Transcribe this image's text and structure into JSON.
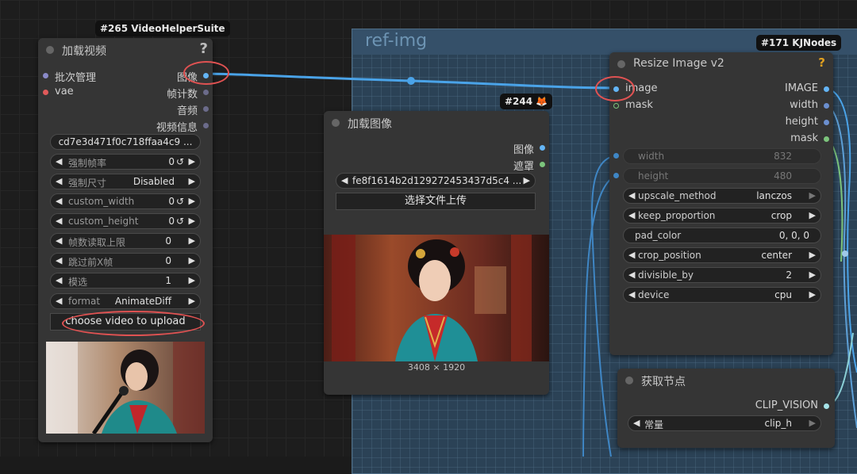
{
  "group": {
    "title": "ref-img"
  },
  "node265": {
    "badge": "#265 VideoHelperSuite",
    "title": "加载视频",
    "help_icon": "?",
    "inputs": [
      {
        "label": "批次管理",
        "color": "#8a8ac8"
      },
      {
        "label": "vae",
        "color": "#e05a5a"
      }
    ],
    "outputs": [
      "图像",
      "帧计数",
      "音频",
      "视频信息"
    ],
    "file_value": "cd7e3d471f0c718ffaa4c9 ...",
    "widgets": [
      {
        "label": "强制帧率",
        "value": "0",
        "suffix": "↺"
      },
      {
        "label": "强制尺寸",
        "value": "Disabled",
        "suffix": ""
      },
      {
        "label": "custom_width",
        "value": "0",
        "suffix": "↺"
      },
      {
        "label": "custom_height",
        "value": "0",
        "suffix": "↺"
      },
      {
        "label": "帧数读取上限",
        "value": "0",
        "suffix": ""
      },
      {
        "label": "跳过前X帧",
        "value": "0",
        "suffix": ""
      },
      {
        "label": "模选",
        "value": "1",
        "suffix": ""
      },
      {
        "label": "format",
        "value": "AnimateDiff",
        "suffix": ""
      }
    ],
    "upload_button": "choose video to upload"
  },
  "node244": {
    "badge": "#244 🦊",
    "title": "加载图像",
    "outputs": [
      "图像",
      "遮罩"
    ],
    "file_value": "fe8f1614b2d129272453437d5c4 ...",
    "upload_button": "选择文件上传",
    "image_caption": "3408 × 1920"
  },
  "node171": {
    "badge": "#171 KJNodes",
    "title": "Resize Image v2",
    "help_icon": "?",
    "inputs": [
      "image",
      "mask"
    ],
    "outputs": [
      "IMAGE",
      "width",
      "height",
      "mask"
    ],
    "disabled_widgets": [
      {
        "label": "width",
        "value": "832"
      },
      {
        "label": "height",
        "value": "480"
      }
    ],
    "widgets": [
      {
        "label": "upscale_method",
        "value": "lanczos"
      },
      {
        "label": "keep_proportion",
        "value": "crop"
      },
      {
        "label": "pad_color",
        "value": "0, 0, 0"
      },
      {
        "label": "crop_position",
        "value": "center"
      },
      {
        "label": "divisible_by",
        "value": "2"
      },
      {
        "label": "device",
        "value": "cpu"
      }
    ]
  },
  "nodeGet": {
    "title": "获取节点",
    "output": "CLIP_VISION",
    "widget": {
      "label": "常量",
      "value": "clip_h"
    }
  },
  "colors": {
    "link_image": "#4aa3e8",
    "annotation_ring": "#e05252",
    "mask_socket": "#7cc47c",
    "image_socket": "#64b5f6",
    "int_socket": "#6b8fcf"
  }
}
